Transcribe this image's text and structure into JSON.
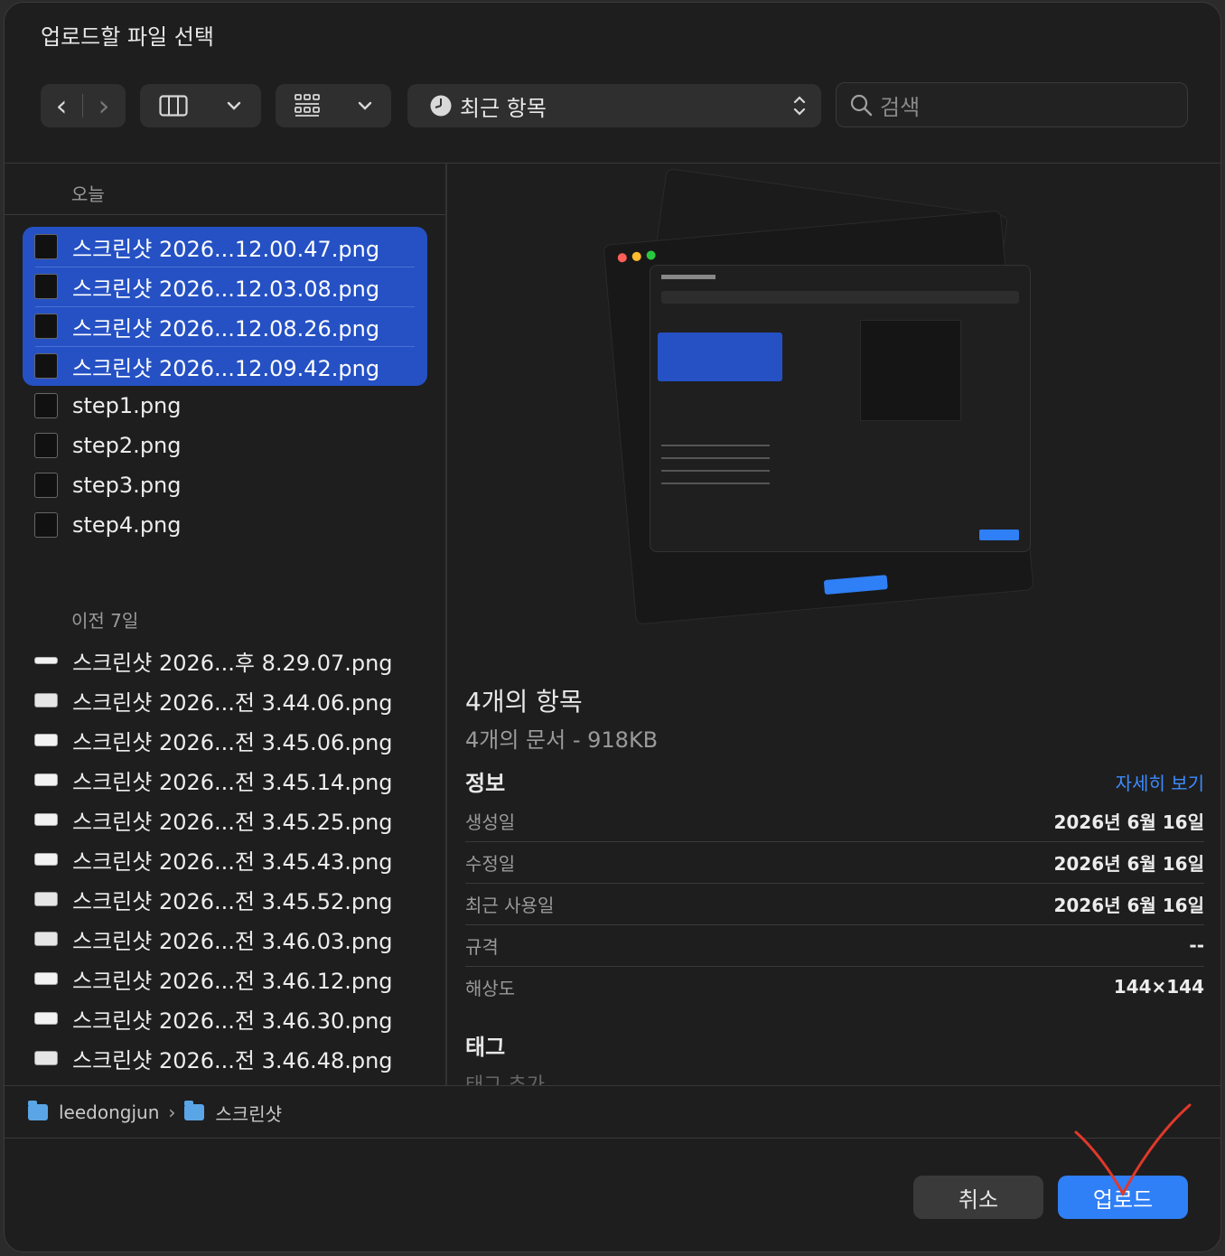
{
  "dialog": {
    "title": "업로드할 파일 선택"
  },
  "toolbar": {
    "back": "‹",
    "forward": "›",
    "view_columns": "columns",
    "view_grid": "grid",
    "location": "최근 항목",
    "search_placeholder": "검색"
  },
  "sidebar": {
    "sections": [
      {
        "label": "오늘",
        "items": [
          {
            "name": "스크린샷 2026...12.00.47.png",
            "selected": true
          },
          {
            "name": "스크린샷 2026...12.03.08.png",
            "selected": true
          },
          {
            "name": "스크린샷 2026...12.08.26.png",
            "selected": true
          },
          {
            "name": "스크린샷 2026...12.09.42.png",
            "selected": true
          },
          {
            "name": "step1.png",
            "selected": false
          },
          {
            "name": "step2.png",
            "selected": false
          },
          {
            "name": "step3.png",
            "selected": false
          },
          {
            "name": "step4.png",
            "selected": false
          }
        ]
      },
      {
        "label": "이전 7일",
        "items": [
          {
            "name": "스크린샷 2026...후 8.29.07.png"
          },
          {
            "name": "스크린샷 2026...전 3.44.06.png"
          },
          {
            "name": "스크린샷 2026...전 3.45.06.png"
          },
          {
            "name": "스크린샷 2026...전 3.45.14.png"
          },
          {
            "name": "스크린샷 2026...전 3.45.25.png"
          },
          {
            "name": "스크린샷 2026...전 3.45.43.png"
          },
          {
            "name": "스크린샷 2026...전 3.45.52.png"
          },
          {
            "name": "스크린샷 2026...전 3.46.03.png"
          },
          {
            "name": "스크린샷 2026...전 3.46.12.png"
          },
          {
            "name": "스크린샷 2026...전 3.46.30.png"
          },
          {
            "name": "스크린샷 2026...전 3.46.48.png"
          }
        ]
      }
    ]
  },
  "preview": {
    "title": "4개의 항목",
    "subtitle": "4개의 문서 - 918KB",
    "info_heading": "정보",
    "more_link": "자세히 보기",
    "rows": [
      {
        "key": "생성일",
        "value": "2026년 6월 16일"
      },
      {
        "key": "수정일",
        "value": "2026년 6월 16일"
      },
      {
        "key": "최근 사용일",
        "value": "2026년 6월 16일"
      },
      {
        "key": "규격",
        "value": "--"
      },
      {
        "key": "해상도",
        "value": "144×144"
      }
    ],
    "tags_heading": "태그",
    "tags_add": "태그 추가"
  },
  "path": {
    "parts": [
      "leedongjun",
      "스크린샷"
    ],
    "separator": "›"
  },
  "buttons": {
    "cancel": "취소",
    "upload": "업로드"
  },
  "colors": {
    "selection": "#2551c4",
    "accent": "#2f7ff6",
    "link": "#3d8bff",
    "annotation": "#e0392a"
  }
}
